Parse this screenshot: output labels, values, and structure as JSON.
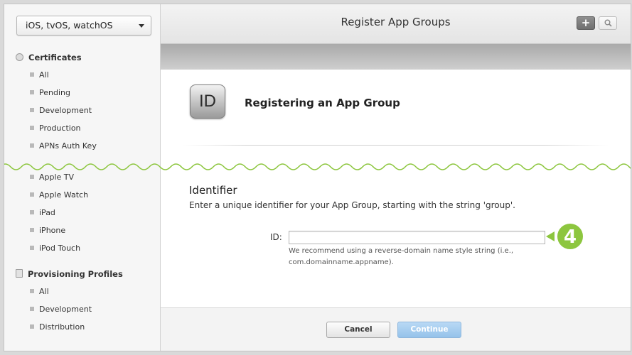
{
  "sidebar": {
    "platform_select": "iOS, tvOS, watchOS",
    "certificates": {
      "title": "Certificates",
      "items": [
        "All",
        "Pending",
        "Development",
        "Production",
        "APNs Auth Key"
      ]
    },
    "devices": {
      "items": [
        "Apple TV",
        "Apple Watch",
        "iPad",
        "iPhone",
        "iPod Touch"
      ]
    },
    "provisioning": {
      "title": "Provisioning Profiles",
      "items": [
        "All",
        "Development",
        "Distribution"
      ]
    }
  },
  "header": {
    "title": "Register App Groups",
    "add_label": "+"
  },
  "content": {
    "tile_text": "ID",
    "heading": "Registering an App Group",
    "identifier_title": "Identifier",
    "identifier_desc": "Enter a unique identifier for your App Group, starting with the string 'group'.",
    "id_label": "ID:",
    "id_value": "",
    "hint_line1": "We recommend using a reverse-domain name style string (i.e.,",
    "hint_line2": "com.domainname.appname).",
    "step_number": "4"
  },
  "footer": {
    "cancel_label": "Cancel",
    "continue_label": "Continue"
  },
  "colors": {
    "accent_green": "#8dc63f",
    "continue_blue": "#a6cdf0"
  }
}
